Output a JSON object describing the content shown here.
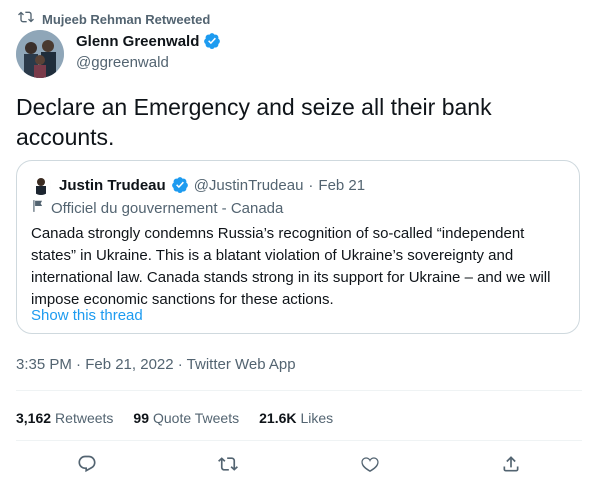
{
  "retweet_header": {
    "label": "Mujeeb Rehman Retweeted",
    "icon": "retweet-icon"
  },
  "author": {
    "name": "Glenn Greenwald",
    "handle": "@ggreenwald",
    "verified": true
  },
  "tweet": {
    "text": "Declare an Emergency and seize all their bank accounts."
  },
  "quoted": {
    "name": "Justin Trudeau",
    "handle": "@JustinTrudeau",
    "separator": "·",
    "date": "Feb 21",
    "label": "Officiel du gouvernement - Canada",
    "text": "Canada strongly condemns Russia’s recognition of so-called “independent states” in Ukraine. This is a blatant violation of Ukraine’s sovereignty and international law. Canada stands strong in its support for Ukraine – and we will impose economic sanctions for these actions.",
    "link": "Show this thread"
  },
  "meta": {
    "timestamp": "3:35 PM · Feb 21, 2022 · Twitter Web App"
  },
  "stats": {
    "retweets": {
      "count": "3,162",
      "label": "Retweets"
    },
    "quotes": {
      "count": "99",
      "label": "Quote Tweets"
    },
    "likes": {
      "count": "21.6K",
      "label": "Likes"
    }
  },
  "actions": [
    "reply-icon",
    "retweet-icon",
    "like-icon",
    "share-icon"
  ],
  "colors": {
    "accent": "#1d9bf0",
    "muted": "#536471",
    "text": "#0f1419",
    "border": "#cfd9de"
  }
}
